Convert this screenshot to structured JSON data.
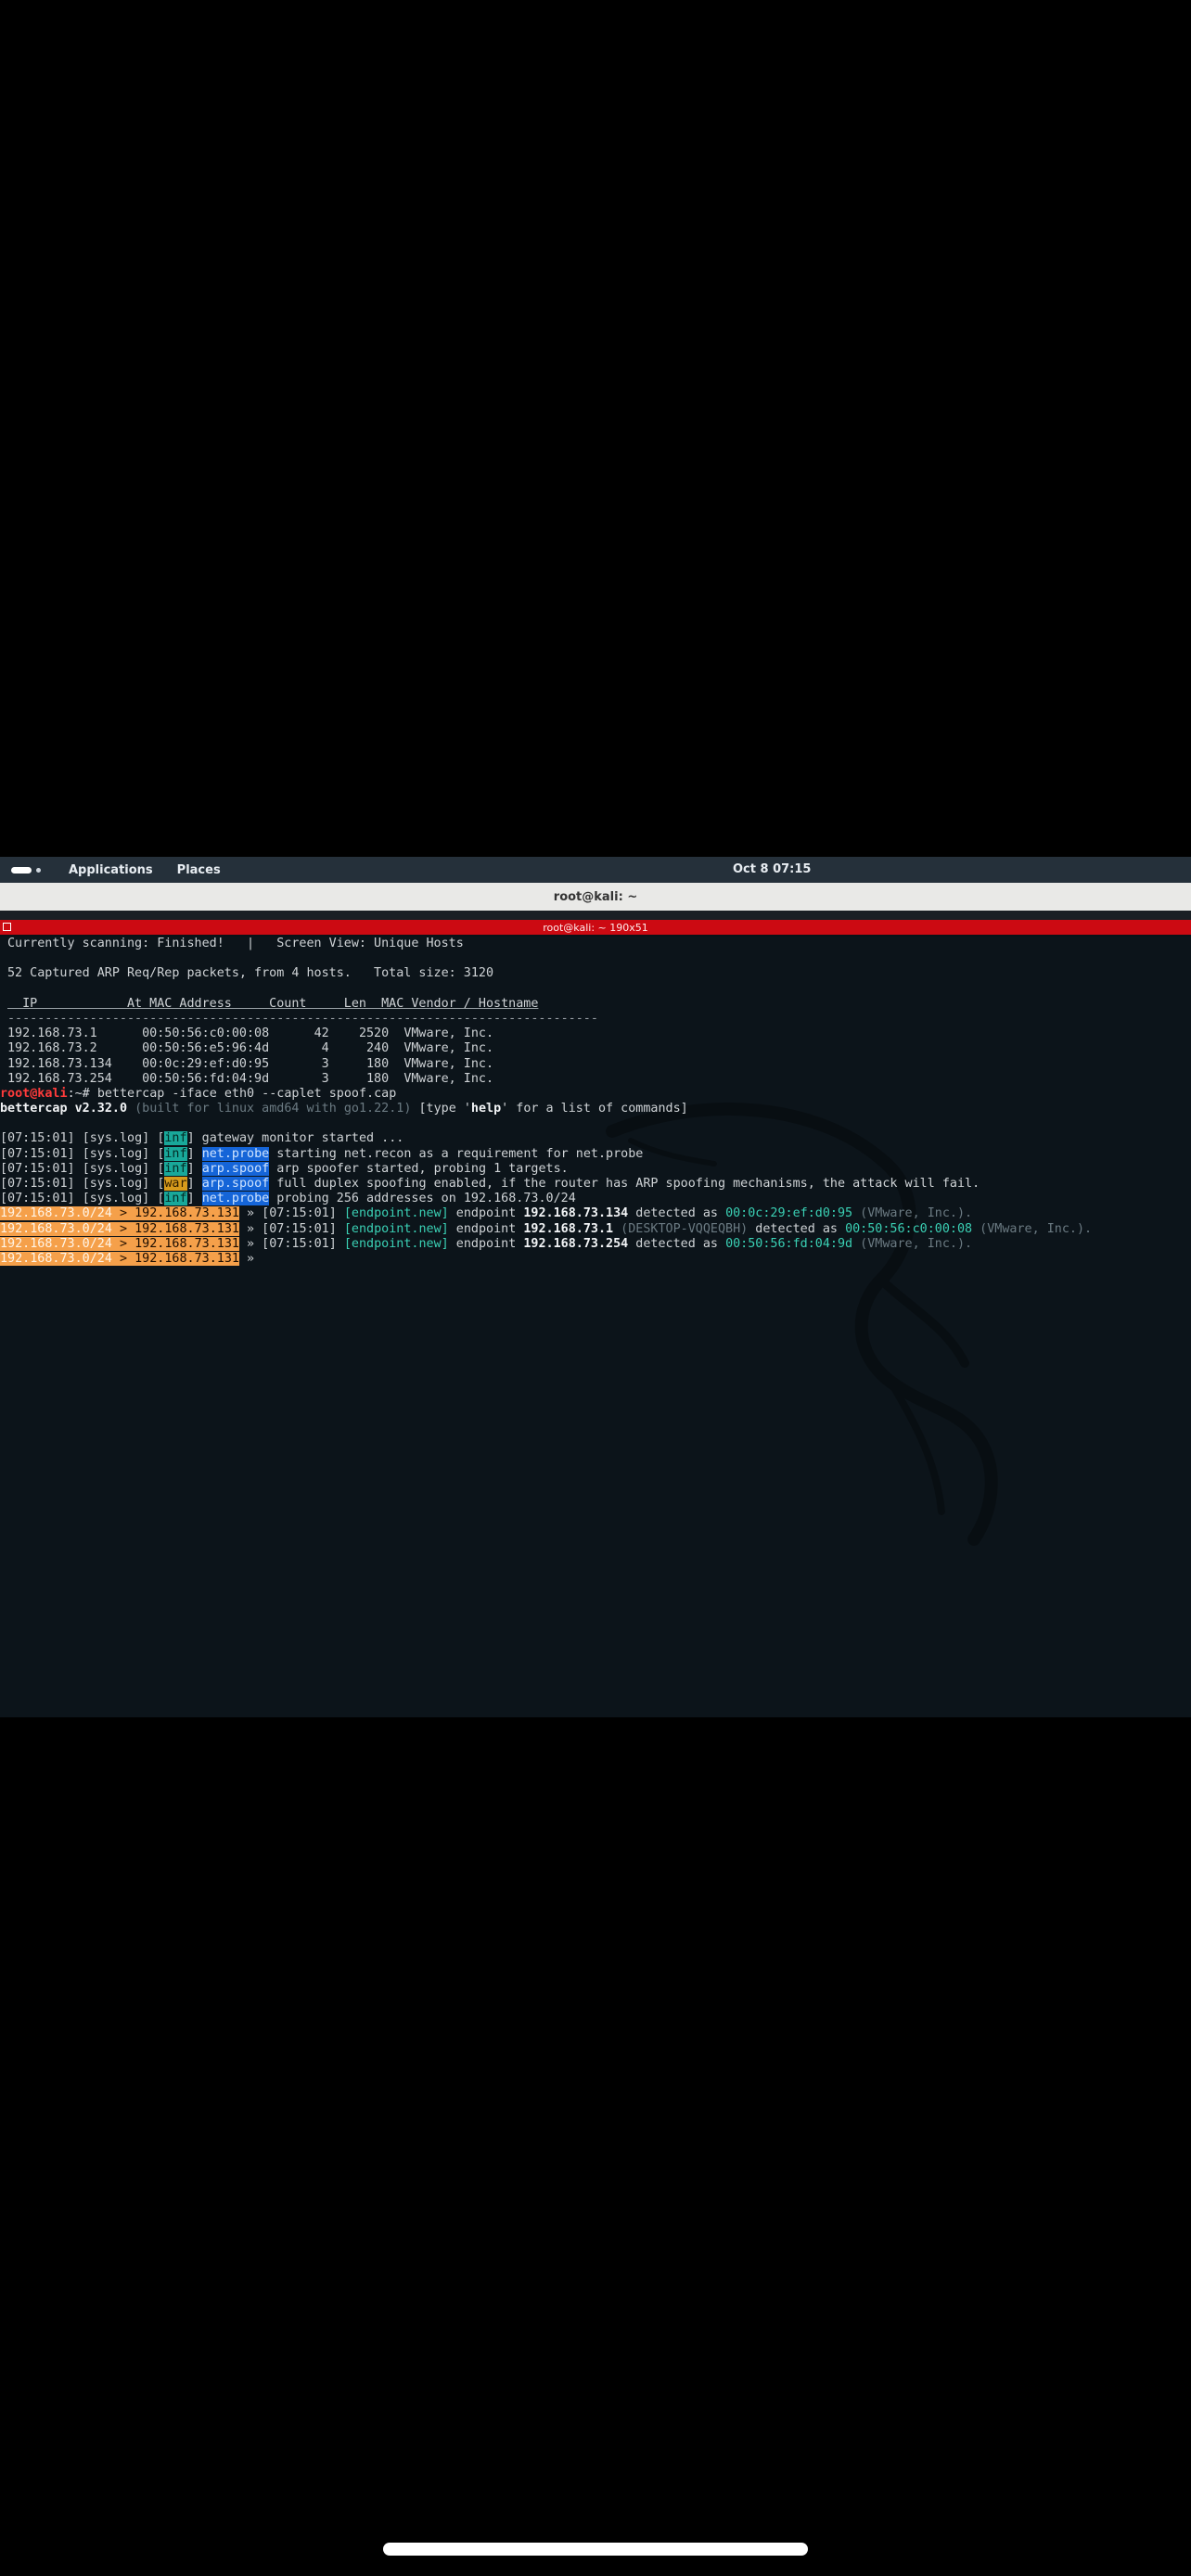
{
  "topbar": {
    "applications": "Applications",
    "places": "Places",
    "clock": "Oct 8  07:15"
  },
  "window": {
    "title": "root@kali: ~"
  },
  "terminal": {
    "header_title": "root@kali: ~ 190x51",
    "status_line": "Currently scanning: Finished!   |   Screen View: Unique Hosts",
    "captured_line": "52 Captured ARP Req/Rep packets, from 4 hosts.   Total size: 3120",
    "table": {
      "header": "  IP            At MAC Address     Count     Len  MAC Vendor / Hostname",
      "rule": "-------------------------------------------------------------------------------",
      "rows": [
        {
          "ip": "192.168.73.1  ",
          "mac": "00:50:56:c0:00:08",
          "count": "42",
          "len": "2520",
          "vendor": "VMware, Inc."
        },
        {
          "ip": "192.168.73.2  ",
          "mac": "00:50:56:e5:96:4d",
          "count": " 4",
          "len": " 240",
          "vendor": "VMware, Inc."
        },
        {
          "ip": "192.168.73.134",
          "mac": "00:0c:29:ef:d0:95",
          "count": " 3",
          "len": " 180",
          "vendor": "VMware, Inc."
        },
        {
          "ip": "192.168.73.254",
          "mac": "00:50:56:fd:04:9d",
          "count": " 3",
          "len": " 180",
          "vendor": "VMware, Inc."
        }
      ]
    },
    "prompt": {
      "user": "root@kali",
      "path": ":~# ",
      "command": "bettercap -iface eth0 --caplet spoof.cap"
    },
    "banner": {
      "name": "bettercap v2.32.0",
      "build": " (built for linux amd64 with go1.22.1) ",
      "help_prefix": "[type '",
      "help_word": "help",
      "help_suffix": "' for a list of commands]"
    },
    "logs": [
      {
        "time": "[07:15:01] ",
        "src": "[sys.log] ",
        "level": "inf",
        "module": "",
        "msg": " gateway monitor started ..."
      },
      {
        "time": "[07:15:01] ",
        "src": "[sys.log] ",
        "level": "inf",
        "module": "net.probe",
        "msg": " starting net.recon as a requirement for net.probe"
      },
      {
        "time": "[07:15:01] ",
        "src": "[sys.log] ",
        "level": "inf",
        "module": "arp.spoof",
        "msg": " arp spoofer started, probing 1 targets."
      },
      {
        "time": "[07:15:01] ",
        "src": "[sys.log] ",
        "level": "war",
        "module": "arp.spoof",
        "msg": " full duplex spoofing enabled, if the router has ARP spoofing mechanisms, the attack will fail."
      },
      {
        "time": "[07:15:01] ",
        "src": "[sys.log] ",
        "level": "inf",
        "module": "net.probe",
        "msg": " probing 256 addresses on 192.168.73.0/24"
      }
    ],
    "events": [
      {
        "subnet": "192.168.73.0/24",
        "arrow": " > ",
        "iface_ip": "192.168.73.131",
        "time": " » [07:15:01] ",
        "tag": "[endpoint.new]",
        "pre": " endpoint ",
        "ip": "192.168.73.134",
        "host": "",
        "mid": " detected as ",
        "mac": "00:0c:29:ef:d0:95",
        "vendor": " (VMware, Inc.)."
      },
      {
        "subnet": "192.168.73.0/24",
        "arrow": " > ",
        "iface_ip": "192.168.73.131",
        "time": " » [07:15:01] ",
        "tag": "[endpoint.new]",
        "pre": " endpoint ",
        "ip": "192.168.73.1",
        "host": " (DESKTOP-VQQEQBH)",
        "mid": " detected as ",
        "mac": "00:50:56:c0:00:08",
        "vendor": " (VMware, Inc.)."
      },
      {
        "subnet": "192.168.73.0/24",
        "arrow": " > ",
        "iface_ip": "192.168.73.131",
        "time": " » [07:15:01] ",
        "tag": "[endpoint.new]",
        "pre": " endpoint ",
        "ip": "192.168.73.254",
        "host": "",
        "mid": " detected as ",
        "mac": "00:50:56:fd:04:9d",
        "vendor": " (VMware, Inc.)."
      }
    ],
    "input_line": {
      "subnet": "192.168.73.0/24",
      "arrow": " > ",
      "iface_ip": "192.168.73.131",
      "cursor": " »"
    }
  }
}
